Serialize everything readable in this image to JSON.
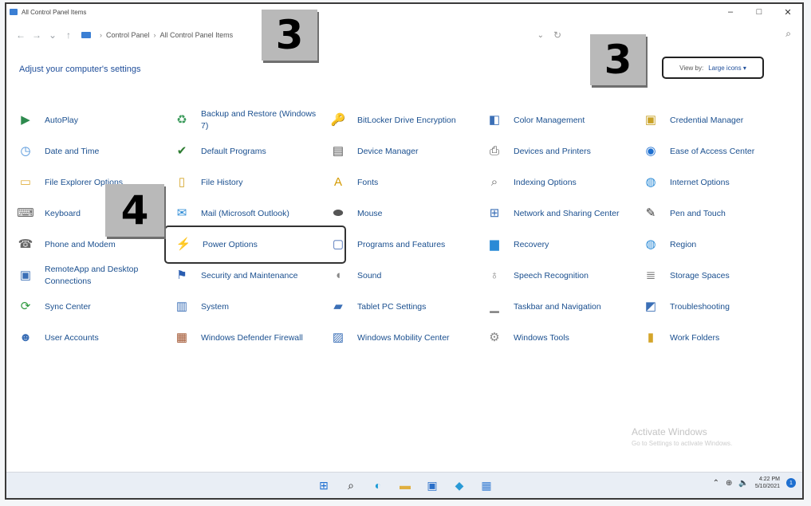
{
  "window": {
    "title": "All Control Panel Items",
    "controls": [
      "–",
      "□",
      "✕"
    ]
  },
  "nav": {
    "back": "←",
    "forward": "→",
    "recent": "⌄",
    "up": "↑",
    "breadcrumb": [
      "Control Panel",
      "All Control Panel Items"
    ],
    "dropdown": "⌄",
    "refresh": "↻",
    "search_icon": "⌕"
  },
  "heading": "Adjust your computer's settings",
  "view_by": {
    "label": "View by:",
    "value": "Large icons ▾"
  },
  "callouts": {
    "a": "3",
    "b": "3",
    "c": "4"
  },
  "items": [
    [
      "AutoPlay",
      "Backup and Restore (Windows 7)",
      "BitLocker Drive Encryption",
      "Color Management",
      "Credential Manager"
    ],
    [
      "Date and Time",
      "Default Programs",
      "Device Manager",
      "Devices and Printers",
      "Ease of Access Center"
    ],
    [
      "File Explorer Options",
      "File History",
      "Fonts",
      "Indexing Options",
      "Internet Options"
    ],
    [
      "Keyboard",
      "Mail (Microsoft Outlook)",
      "Mouse",
      "Network and Sharing Center",
      "Pen and Touch"
    ],
    [
      "Phone and Modem",
      "Power Options",
      "Programs and Features",
      "Recovery",
      "Region"
    ],
    [
      "RemoteApp and Desktop Connections",
      "Security and Maintenance",
      "Sound",
      "Speech Recognition",
      "Storage Spaces"
    ],
    [
      "Sync Center",
      "System",
      "Tablet PC Settings",
      "Taskbar and Navigation",
      "Troubleshooting"
    ],
    [
      "User Accounts",
      "Windows Defender Firewall",
      "Windows Mobility Center",
      "Windows Tools",
      "Work Folders"
    ]
  ],
  "icons": [
    [
      "autoplay-icon",
      "backup-icon",
      "bitlocker-icon",
      "color-management-icon",
      "credential-icon"
    ],
    [
      "clock-icon",
      "default-programs-icon",
      "device-manager-icon",
      "printer-icon",
      "ease-of-access-icon"
    ],
    [
      "folder-options-icon",
      "file-history-icon",
      "fonts-icon",
      "indexing-icon",
      "internet-icon"
    ],
    [
      "keyboard-icon",
      "mail-icon",
      "mouse-icon",
      "network-icon",
      "pen-icon"
    ],
    [
      "phone-icon",
      "power-icon",
      "programs-icon",
      "recovery-icon",
      "globe-icon"
    ],
    [
      "remote-desktop-icon",
      "security-flag-icon",
      "sound-icon",
      "microphone-icon",
      "storage-icon"
    ],
    [
      "sync-icon",
      "system-icon",
      "tablet-icon",
      "taskbar-icon",
      "troubleshooting-icon"
    ],
    [
      "users-icon",
      "firewall-icon",
      "mobility-icon",
      "tools-gear-icon",
      "work-folders-icon"
    ]
  ],
  "icon_colors": [
    [
      "#2d8a4e",
      "#3a9a5a",
      "#8a7a40",
      "#3b6fb6",
      "#c9a227"
    ],
    [
      "#4a90d9",
      "#2e7d32",
      "#555555",
      "#555555",
      "#1e6fd0"
    ],
    [
      "#e0b040",
      "#d4a52a",
      "#d49a00",
      "#666666",
      "#2a8ad6"
    ],
    [
      "#666666",
      "#2a8ad6",
      "#555555",
      "#3b6fb6",
      "#333333"
    ],
    [
      "#666666",
      "#3a9a5a",
      "#4a6fb6",
      "#2a8ad6",
      "#2a8ad6"
    ],
    [
      "#3b6fb6",
      "#2a5db0",
      "#888888",
      "#888888",
      "#777777"
    ],
    [
      "#2e9a3e",
      "#3b6fb6",
      "#3b6fb6",
      "#777777",
      "#3b6fb6"
    ],
    [
      "#3b6fb6",
      "#a0522d",
      "#3b6fb6",
      "#888888",
      "#d4a52a"
    ]
  ],
  "highlighted": "Power Options",
  "watermark": {
    "line1": "Activate Windows",
    "line2": "Go to Settings to activate Windows."
  },
  "taskbar": {
    "icons": [
      "windows-start-icon",
      "search-icon",
      "edge-icon",
      "file-explorer-icon",
      "store-icon",
      "photos-icon",
      "control-panel-icon"
    ],
    "tray": {
      "chevron": "⌃",
      "time": "4:22 PM",
      "date": "5/10/2021",
      "notifications": "1"
    }
  }
}
